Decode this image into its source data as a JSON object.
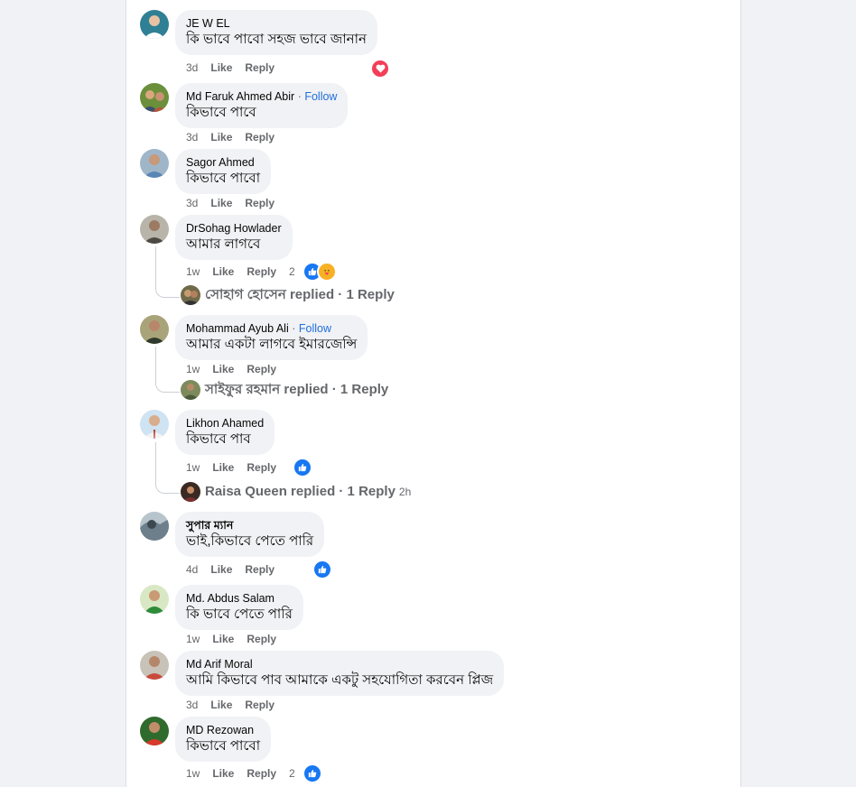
{
  "colors": {
    "like_blue": "#1877f2",
    "love_red": "#f33e58",
    "follow_blue": "#216fdb"
  },
  "comments": [
    {
      "author": "JE W EL",
      "text": "কি ভাবে পাবো সহজ ভাবে জানান",
      "time": "3d",
      "like": "Like",
      "reply": "Reply",
      "reactions": [
        "heart-icon"
      ]
    },
    {
      "author": "Md Faruk Ahmed Abir",
      "follow": "Follow",
      "text": "কিভাবে পাবে",
      "time": "3d",
      "like": "Like",
      "reply": "Reply"
    },
    {
      "author": "Sagor Ahmed",
      "text": "কিভাবে পাবো",
      "time": "3d",
      "like": "Like",
      "reply": "Reply"
    },
    {
      "author": "DrSohag Howlader",
      "text": "আমার লাগবে",
      "time": "1w",
      "like": "Like",
      "reply": "Reply",
      "reaction_count": "2",
      "reactions": [
        "like-icon",
        "care-icon"
      ],
      "reply_summary": {
        "name": "সোহাগ হোসেন",
        "text": "replied · 1 Reply"
      }
    },
    {
      "author": "Mohammad Ayub Ali",
      "follow": "Follow",
      "text": "আমার একটা লাগবে ইমারজেন্সি",
      "time": "1w",
      "like": "Like",
      "reply": "Reply",
      "reply_summary": {
        "name": "সাইফুর রহমান",
        "text": "replied · 1 Reply"
      }
    },
    {
      "author": "Likhon Ahamed",
      "text": "কিভাবে পাব",
      "time": "1w",
      "like": "Like",
      "reply": "Reply",
      "reactions": [
        "like-icon"
      ],
      "reply_summary": {
        "name": "Raisa Queen",
        "text": "replied · 1 Reply",
        "time": "2h"
      }
    },
    {
      "author": "সুপার ম্যান",
      "text": "ভাই,কিভাবে পেতে পারি",
      "time": "4d",
      "like": "Like",
      "reply": "Reply",
      "reactions": [
        "like-icon"
      ]
    },
    {
      "author": "Md. Abdus Salam",
      "text": "কি ভাবে পেতে পারি",
      "time": "1w",
      "like": "Like",
      "reply": "Reply"
    },
    {
      "author": "Md Arif Moral",
      "text": "আমি কিভাবে পাব আমাকে একটু সহযোগিতা করবেন প্লিজ",
      "time": "3d",
      "like": "Like",
      "reply": "Reply"
    },
    {
      "author": "MD Rezowan",
      "text": "কিভাবে পাবো",
      "time": "1w",
      "like": "Like",
      "reply": "Reply",
      "reaction_count": "2",
      "reactions": [
        "like-icon"
      ]
    }
  ]
}
